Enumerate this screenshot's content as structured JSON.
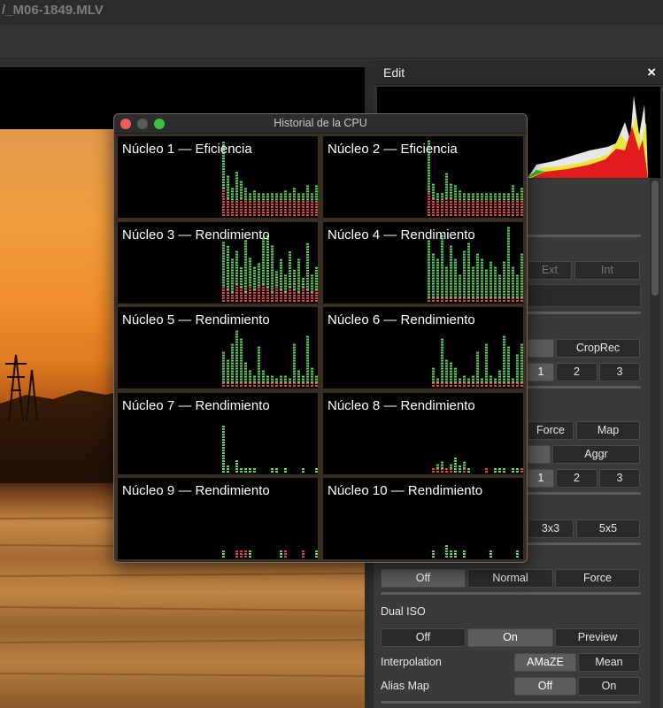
{
  "app": {
    "window_title": "/_M06-1849.MLV"
  },
  "edit": {
    "title": "Edit",
    "close_glyph": "×",
    "buttons": {
      "ext": "Ext",
      "int": "Int",
      "croprec": "CropRec",
      "row_a": [
        "1",
        "2",
        "3"
      ],
      "force_map": [
        "Force",
        "Map"
      ],
      "aggr": "Aggr",
      "row_b": [
        "1",
        "2",
        "3"
      ],
      "kernel": [
        "3x3",
        "5x5"
      ],
      "mode": [
        "Off",
        "Normal",
        "Force"
      ]
    },
    "dual_iso": {
      "label": "Dual ISO",
      "options": [
        "Off",
        "On",
        "Preview"
      ],
      "selected": "On"
    },
    "interpolation": {
      "label": "Interpolation",
      "options": [
        "AMaZE",
        "Mean"
      ],
      "selected": "AMaZE"
    },
    "alias_map": {
      "label": "Alias Map",
      "options": [
        "Off",
        "On"
      ],
      "selected": "Off"
    }
  },
  "cpu": {
    "title": "Historial de la CPU",
    "cores": [
      {
        "label": "Núcleo 1 — Eficiencia",
        "green": [
          0,
          0,
          0,
          0,
          0,
          0,
          0,
          0,
          0,
          0,
          0,
          0,
          0,
          0,
          0,
          0,
          0,
          0,
          0,
          0,
          0,
          0,
          0,
          0,
          0,
          0,
          0,
          0,
          0,
          0,
          0,
          0,
          0,
          0,
          0,
          0,
          0,
          0,
          0,
          0,
          0,
          0,
          0,
          0,
          0,
          0,
          0,
          0,
          0,
          0,
          0,
          0,
          0,
          0,
          0,
          0,
          0,
          0,
          0,
          0,
          0,
          0,
          0,
          0,
          0,
          0,
          0,
          0,
          0,
          0,
          0,
          0,
          0,
          0,
          0,
          0,
          0,
          0,
          0,
          0,
          0,
          0,
          0,
          0,
          0,
          0,
          0,
          0,
          0,
          0,
          0,
          0,
          0,
          0,
          0,
          0,
          0,
          0,
          0,
          0,
          0,
          0,
          0,
          0,
          0,
          0,
          0,
          0,
          0,
          0,
          0,
          0,
          0,
          0,
          0,
          0,
          0,
          0,
          0,
          0,
          0,
          0,
          0,
          0,
          0,
          0,
          0,
          0,
          0,
          0,
          0,
          0,
          0,
          0,
          0,
          0,
          0,
          0,
          0,
          0,
          0,
          0,
          0,
          0,
          0,
          0,
          0,
          0,
          0,
          0,
          0,
          0,
          0,
          0,
          0,
          0,
          0,
          0,
          0,
          0,
          0,
          0,
          0,
          0,
          0,
          0,
          0,
          0,
          0,
          0,
          0,
          0,
          0,
          0,
          0,
          0,
          0,
          0,
          0,
          0,
          0,
          0,
          0,
          0,
          0,
          0,
          0,
          0,
          0,
          0,
          0,
          0,
          0,
          0,
          0,
          0,
          0,
          0,
          0,
          0,
          0,
          0,
          0,
          0,
          0,
          0,
          0,
          0,
          0,
          0,
          0,
          0,
          0,
          0,
          0,
          0,
          0,
          0,
          0,
          0,
          0,
          0,
          0,
          0,
          0,
          0,
          0,
          0,
          0,
          0,
          0,
          0,
          0,
          0,
          0,
          0,
          0,
          0,
          0,
          0,
          0,
          0,
          0,
          0
        ],
        "total": [
          0.95,
          0.5,
          0.35,
          0.55,
          0.45,
          0.35,
          0.3,
          0.32,
          0.28,
          0.28,
          0.28,
          0.28,
          0.28,
          0.28,
          0.32,
          0.28,
          0.35,
          0.28,
          0.28,
          0.4,
          0.3,
          0.38,
          0.28
        ],
        "red": [
          0.35,
          0.22,
          0.2,
          0.2,
          0.22,
          0.2,
          0.2,
          0.2,
          0.2,
          0.2,
          0.2,
          0.2,
          0.2,
          0.2,
          0.2,
          0.2,
          0.2,
          0.2,
          0.2,
          0.2,
          0.2,
          0.2,
          0.2
        ]
      },
      {
        "label": "Núcleo 2 — Eficiencia",
        "total": [
          0.95,
          0.4,
          0.3,
          0.3,
          0.55,
          0.4,
          0.4,
          0.32,
          0.3,
          0.28,
          0.28,
          0.3,
          0.28,
          0.28,
          0.3,
          0.3,
          0.28,
          0.28,
          0.28,
          0.38,
          0.3,
          0.35,
          0.28
        ],
        "red": [
          0.3,
          0.22,
          0.2,
          0.2,
          0.22,
          0.22,
          0.2,
          0.2,
          0.2,
          0.2,
          0.2,
          0.2,
          0.2,
          0.2,
          0.2,
          0.2,
          0.2,
          0.2,
          0.2,
          0.2,
          0.2,
          0.2,
          0.2
        ]
      },
      {
        "label": "Núcleo 3 — Rendimiento",
        "total": [
          0.75,
          0.7,
          0.55,
          0.65,
          0.45,
          0.8,
          0.55,
          0.45,
          0.5,
          0.8,
          0.85,
          0.7,
          0.4,
          0.55,
          0.35,
          0.65,
          0.4,
          0.55,
          0.3,
          0.75,
          0.35,
          0.45,
          0.7
        ],
        "red": [
          0.2,
          0.15,
          0.12,
          0.22,
          0.18,
          0.12,
          0.2,
          0.15,
          0.2,
          0.22,
          0.18,
          0.12,
          0.2,
          0.15,
          0.12,
          0.18,
          0.15,
          0.12,
          0.18,
          0.15,
          0.12,
          0.15,
          0.12
        ]
      },
      {
        "label": "Núcleo 4 — Rendimiento",
        "total": [
          0.8,
          0.6,
          0.55,
          0.85,
          0.45,
          0.7,
          0.55,
          0.35,
          0.65,
          0.75,
          0.45,
          0.6,
          0.55,
          0.4,
          0.5,
          0.45,
          0.35,
          0.5,
          0.95,
          0.45,
          0.35,
          0.6,
          0.35
        ],
        "red": [
          0.05,
          0.05,
          0.05,
          0.05,
          0.05,
          0.05,
          0.05,
          0.05,
          0.05,
          0.05,
          0.05,
          0.05,
          0.05,
          0.05,
          0.05,
          0.05,
          0.05,
          0.05,
          0.05,
          0.05,
          0.05,
          0.05,
          0.05
        ]
      },
      {
        "label": "Núcleo 5 — Rendimiento",
        "total": [
          0.45,
          0.35,
          0.55,
          0.7,
          0.6,
          0.3,
          0.2,
          0.15,
          0.5,
          0.2,
          0.15,
          0.12,
          0.1,
          0.12,
          0.15,
          0.1,
          0.55,
          0.2,
          0.12,
          0.65,
          0.25,
          0.12,
          0.1
        ],
        "red": [
          0.05,
          0.05,
          0.05,
          0.05,
          0.05,
          0.05,
          0.05,
          0.05,
          0.05,
          0.05,
          0.05,
          0.05,
          0.05,
          0.05,
          0.05,
          0.05,
          0.05,
          0.05,
          0.05,
          0.05,
          0.05,
          0.05,
          0.05
        ]
      },
      {
        "label": "Núcleo 6 — Rendimiento",
        "total": [
          0.0,
          0.25,
          0.1,
          0.6,
          0.35,
          0.3,
          0.25,
          0.1,
          0.15,
          0.1,
          0.12,
          0.45,
          0.1,
          0.55,
          0.15,
          0.1,
          0.2,
          0.65,
          0.5,
          0.1,
          0.4,
          0.55,
          0.1
        ],
        "red": [
          0.0,
          0.05,
          0.05,
          0.05,
          0.05,
          0.05,
          0.05,
          0.05,
          0.05,
          0.05,
          0.05,
          0.05,
          0.05,
          0.05,
          0.05,
          0.05,
          0.05,
          0.05,
          0.05,
          0.05,
          0.05,
          0.05,
          0.05
        ]
      },
      {
        "label": "Núcleo 7 — Rendimiento",
        "total": [
          0.6,
          0.1,
          0.0,
          0.15,
          0.05,
          0.05,
          0.05,
          0.05,
          0.0,
          0.0,
          0.0,
          0.05,
          0.05,
          0.0,
          0.05,
          0.0,
          0.0,
          0.0,
          0.05,
          0.0,
          0.0,
          0.05,
          0.05
        ],
        "red": [
          0,
          0,
          0,
          0,
          0,
          0,
          0,
          0,
          0,
          0,
          0,
          0,
          0,
          0,
          0,
          0,
          0,
          0,
          0,
          0,
          0,
          0,
          0
        ]
      },
      {
        "label": "Núcleo 8 — Rendimiento",
        "total": [
          0.0,
          0.05,
          0.1,
          0.15,
          0.05,
          0.1,
          0.2,
          0.08,
          0.12,
          0.05,
          0.0,
          0.0,
          0.0,
          0.05,
          0.0,
          0.05,
          0.05,
          0.05,
          0.0,
          0.05,
          0.05,
          0.05,
          0.0
        ],
        "red": [
          0.0,
          0.05,
          0.05,
          0.05,
          0.05,
          0.05,
          0.0,
          0.0,
          0.05,
          0.0,
          0.0,
          0.0,
          0.0,
          0.05,
          0.0,
          0.0,
          0.0,
          0.0,
          0.0,
          0.0,
          0.0,
          0.05,
          0.0
        ]
      },
      {
        "label": "Núcleo 9 — Rendimiento",
        "total": [
          0.08,
          0.0,
          0.0,
          0.08,
          0.08,
          0.08,
          0.08,
          0.0,
          0.0,
          0.0,
          0.0,
          0.0,
          0.0,
          0.08,
          0.08,
          0.0,
          0.0,
          0.0,
          0.08,
          0.0,
          0.0,
          0.08,
          0.0
        ],
        "red": [
          0.0,
          0,
          0,
          0.08,
          0.08,
          0.08,
          0,
          0,
          0,
          0,
          0,
          0,
          0,
          0,
          0.08,
          0,
          0,
          0,
          0.08,
          0,
          0,
          0,
          0
        ]
      },
      {
        "label": "Núcleo 10 — Rendimiento",
        "total": [
          0.0,
          0.08,
          0.0,
          0.0,
          0.15,
          0.08,
          0.08,
          0.0,
          0.08,
          0.0,
          0.0,
          0.0,
          0.0,
          0.0,
          0.08,
          0.0,
          0.0,
          0.0,
          0.0,
          0.0,
          0.08,
          0.0,
          0.0
        ],
        "red": [
          0,
          0,
          0,
          0,
          0,
          0,
          0,
          0,
          0,
          0,
          0,
          0,
          0,
          0,
          0,
          0,
          0,
          0,
          0,
          0,
          0,
          0,
          0
        ]
      }
    ]
  },
  "colors": {
    "green": "#5fd35a",
    "red": "#d9443a",
    "panel_bg": "#000000",
    "window_frame": "#3a2d22"
  }
}
